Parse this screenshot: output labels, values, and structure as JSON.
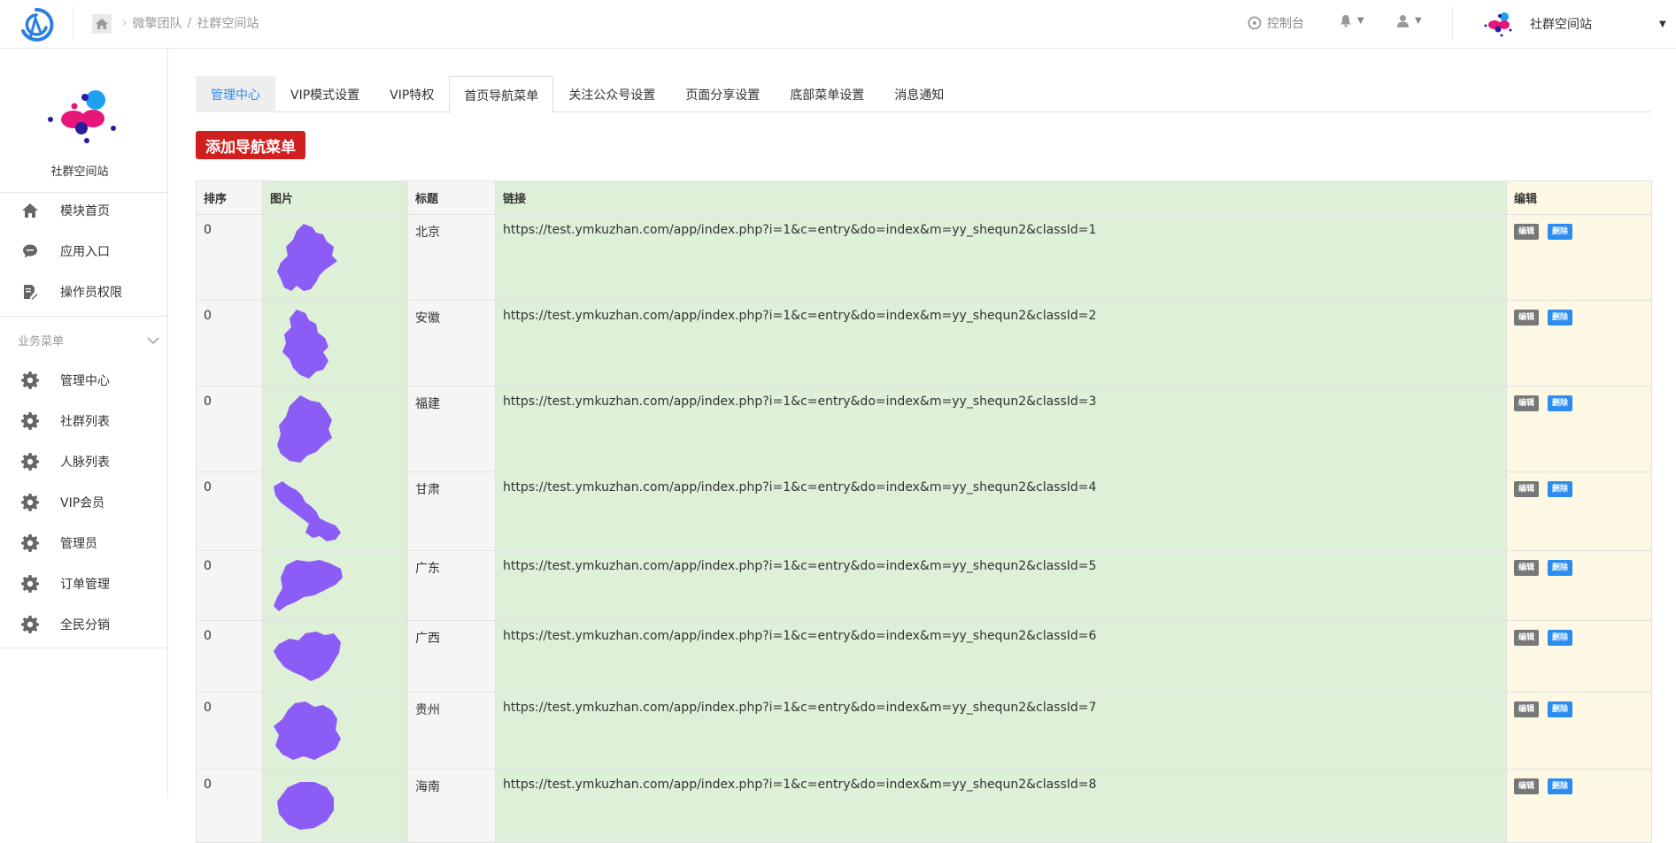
{
  "header": {
    "breadcrumb": [
      "微擎团队",
      "社群空间站"
    ],
    "breadcrumb_sep": "/",
    "console_label": "控制台",
    "account_name": "社群空间站"
  },
  "sidebar": {
    "site_title": "社群空间站",
    "top_items": [
      {
        "label": "模块首页",
        "icon": "home-icon"
      },
      {
        "label": "应用入口",
        "icon": "chat-icon"
      },
      {
        "label": "操作员权限",
        "icon": "edit-doc-icon"
      }
    ],
    "group_title": "业务菜单",
    "group_items": [
      {
        "label": "管理中心",
        "icon": "gear-icon"
      },
      {
        "label": "社群列表",
        "icon": "gear-icon"
      },
      {
        "label": "人脉列表",
        "icon": "gear-icon"
      },
      {
        "label": "VIP会员",
        "icon": "gear-icon"
      },
      {
        "label": "管理员",
        "icon": "gear-icon"
      },
      {
        "label": "订单管理",
        "icon": "gear-icon"
      },
      {
        "label": "全民分销",
        "icon": "gear-icon"
      }
    ]
  },
  "tabs": [
    "管理中心",
    "VIP模式设置",
    "VIP特权",
    "首页导航菜单",
    "关注公众号设置",
    "页面分享设置",
    "底部菜单设置",
    "消息通知"
  ],
  "active_tab": "首页导航菜单",
  "add_button_label": "添加导航菜单",
  "table": {
    "headers": [
      "排序",
      "图片",
      "标题",
      "链接",
      "编辑"
    ],
    "edit_label": "编辑",
    "delete_label": "删除",
    "rows": [
      {
        "sort": "0",
        "title": "北京",
        "link": "https://test.ymkuzhan.com/app/index.php?i=1&c=entry&do=index&m=yy_shequn2&classId=1"
      },
      {
        "sort": "0",
        "title": "安徽",
        "link": "https://test.ymkuzhan.com/app/index.php?i=1&c=entry&do=index&m=yy_shequn2&classId=2"
      },
      {
        "sort": "0",
        "title": "福建",
        "link": "https://test.ymkuzhan.com/app/index.php?i=1&c=entry&do=index&m=yy_shequn2&classId=3"
      },
      {
        "sort": "0",
        "title": "甘肃",
        "link": "https://test.ymkuzhan.com/app/index.php?i=1&c=entry&do=index&m=yy_shequn2&classId=4"
      },
      {
        "sort": "0",
        "title": "广东",
        "link": "https://test.ymkuzhan.com/app/index.php?i=1&c=entry&do=index&m=yy_shequn2&classId=5"
      },
      {
        "sort": "0",
        "title": "广西",
        "link": "https://test.ymkuzhan.com/app/index.php?i=1&c=entry&do=index&m=yy_shequn2&classId=6"
      },
      {
        "sort": "0",
        "title": "贵州",
        "link": "https://test.ymkuzhan.com/app/index.php?i=1&c=entry&do=index&m=yy_shequn2&classId=7"
      },
      {
        "sort": "0",
        "title": "海南",
        "link": "https://test.ymkuzhan.com/app/index.php?i=1&c=entry&do=index&m=yy_shequn2&classId=8"
      }
    ]
  },
  "colors": {
    "accent_blue": "#2d8cf0",
    "add_button_red": "#d01f1f",
    "map_purple": "#8b5cf6",
    "row_green": "#dff0d8",
    "row_yellow": "#fcf8e3"
  }
}
